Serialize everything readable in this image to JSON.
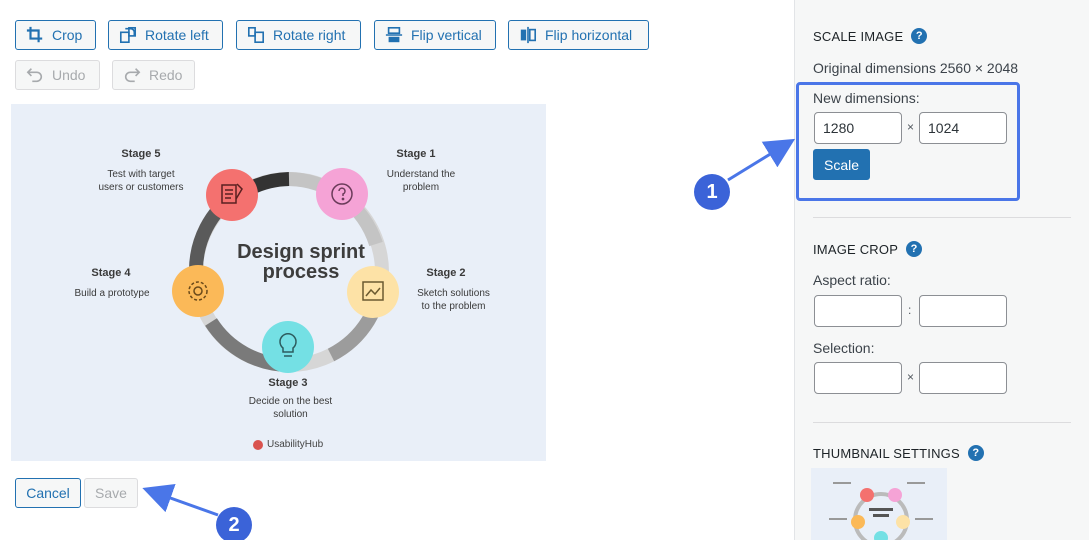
{
  "toolbar": {
    "crop": "Crop",
    "rotate_left": "Rotate left",
    "rotate_right": "Rotate right",
    "flip_vertical": "Flip vertical",
    "flip_horizontal": "Flip horizontal",
    "undo": "Undo",
    "redo": "Redo"
  },
  "image": {
    "title_line1": "Design sprint",
    "title_line2": "process",
    "stages": [
      {
        "name": "Stage 1",
        "desc1": "Understand the",
        "desc2": "problem",
        "color": "#f5a3d6"
      },
      {
        "name": "Stage 2",
        "desc1": "Sketch solutions",
        "desc2": "to the problem",
        "color": "#fde2a6"
      },
      {
        "name": "Stage 3",
        "desc1": "Decide on the best",
        "desc2": "solution",
        "color": "#74e0e4"
      },
      {
        "name": "Stage 4",
        "desc1": "Build a prototype",
        "desc2": "",
        "color": "#fbb958"
      },
      {
        "name": "Stage 5",
        "desc1": "Test with target",
        "desc2": "users or customers",
        "color": "#f4716f"
      }
    ],
    "brand": "UsabilityHub"
  },
  "actions": {
    "cancel": "Cancel",
    "save": "Save"
  },
  "panel": {
    "scale_title": "Scale Image",
    "original_dimensions": "Original dimensions 2560 × 2048",
    "new_dimensions_label": "New dimensions:",
    "width_value": "1280",
    "height_value": "1024",
    "times": "×",
    "scale_button": "Scale",
    "crop_title": "Image Crop",
    "aspect_ratio_label": "Aspect ratio:",
    "colon": ":",
    "selection_label": "Selection:",
    "thumbnail_title": "Thumbnail Settings"
  },
  "annotations": {
    "badge1": "1",
    "badge2": "2"
  },
  "colors": {
    "primary": "#2271b1",
    "highlight": "#4a76e8",
    "badge": "#3b63d8"
  }
}
